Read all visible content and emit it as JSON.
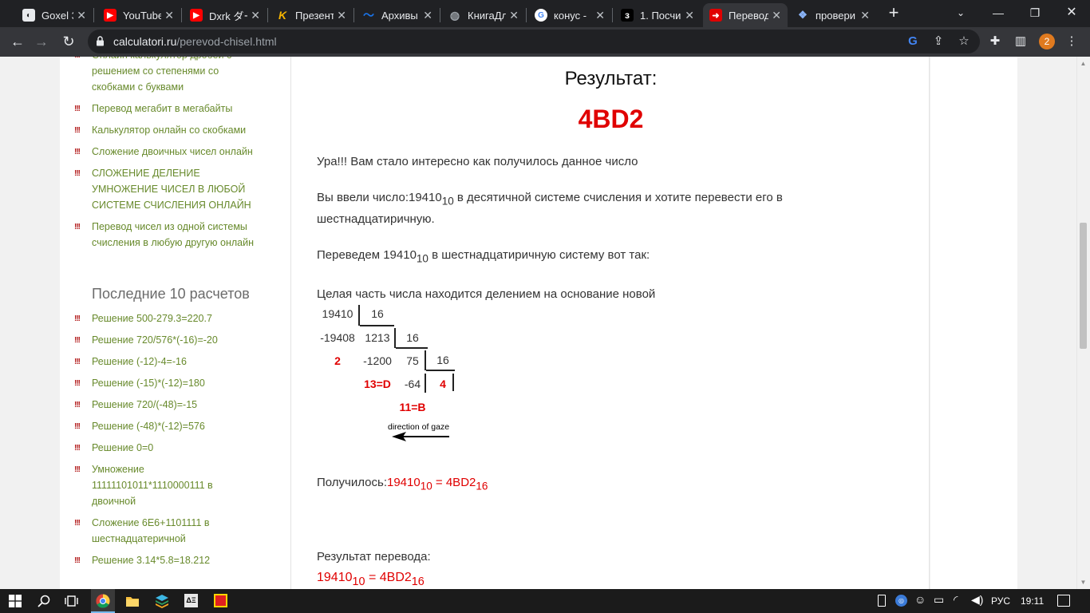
{
  "browser": {
    "tabs": [
      {
        "label": "Goxel 3D",
        "icon": "goxel-icon",
        "color": "#5f6368"
      },
      {
        "label": "YouTube",
        "icon": "youtube-icon",
        "color": "#ff0000"
      },
      {
        "label": "Dxrk ダー",
        "icon": "youtube-icon",
        "color": "#ff0000"
      },
      {
        "label": "Презент",
        "icon": "k-logo-icon",
        "color": "#f5b400"
      },
      {
        "label": "Архивы",
        "icon": "archive-icon",
        "color": "#1a73e8"
      },
      {
        "label": "КнигаДл",
        "icon": "globe-icon",
        "color": "#9aa0a6"
      },
      {
        "label": "конус -",
        "icon": "google-icon",
        "color": "#4285f4"
      },
      {
        "label": "1. Посчи",
        "icon": "z-logo-icon",
        "color": "#000000"
      },
      {
        "label": "Перевод",
        "icon": "calculatori-icon",
        "color": "#e00000",
        "active": true
      },
      {
        "label": "провери",
        "icon": "nodes-icon",
        "color": "#8ab4f8"
      }
    ],
    "url_domain": "calculatori.ru",
    "url_path": "/perevod-chisel.html",
    "profile_count": "2"
  },
  "sidebar": {
    "partial_item": "Онлайн калькулятор дробей с решением со степенями со скобками с буквами",
    "links": [
      "Перевод мегабит в мегабайты",
      "Калькулятор онлайн со скобками",
      "Сложение двоичных чисел онлайн",
      "СЛОЖЕНИЕ ДЕЛЕНИЕ УМНОЖЕНИЕ ЧИСЕЛ В ЛЮБОЙ СИСТЕМЕ СЧИСЛЕНИЯ ОНЛАЙН",
      "Перевод чисел из одной системы счисления в любую другую онлайн"
    ],
    "recent_heading": "Последние 10 расчетов",
    "recent": [
      "Решение 500-279.3=220.7",
      "Решение 720/576*(-16)=-20",
      "Решение (-12)-4=-16",
      "Решение (-15)*(-12)=180",
      "Решение 720/(-48)=-15",
      "Решение (-48)*(-12)=576",
      "Решение 0=0",
      "Умножение 11111101011*1110000111 в двоичной",
      "Сложение 6E6+1101111 в шестнадцатеричной",
      "Решение 3.14*5.8=18.212"
    ],
    "bullet": "!!!"
  },
  "main": {
    "result_title": "Результат:",
    "result_value": "4BD2",
    "hooray": "Ура!!! Вам стало интересно как получилось данное число",
    "entered_prefix": "Вы ввели число:19410",
    "entered_sub": "10",
    "entered_suffix": " в десятичной системе счисления и хотите перевести его в",
    "entered_line2": "шестнадцатиричную.",
    "convert_prefix": "Переведем 19410",
    "convert_sub": "10",
    "convert_suffix": " в шестнадцатиричную систему вот так:",
    "integer_part": "Целая часть числа находится делением на основание новой",
    "division": {
      "n1": "19410",
      "d1": "16",
      "m1": "-19408",
      "q1": "1213",
      "d2": "16",
      "r1": "2",
      "m2": "-1200",
      "q2": "75",
      "d3": "16",
      "r2": "13=D",
      "m3": "-64",
      "q3": "4",
      "r3": "11=B"
    },
    "gaze_label": "direction of gaze",
    "got_label": "Получилось:",
    "got_num": "19410",
    "got_sub1": "10",
    "got_eq": " = 4BD2",
    "got_sub2": "16",
    "final_label": "Результат перевода:",
    "final_num": "19410",
    "final_sub1": "10",
    "final_eq": " = 4BD2",
    "final_sub2": "16"
  },
  "taskbar": {
    "lang": "РУС",
    "time": "19:11"
  }
}
